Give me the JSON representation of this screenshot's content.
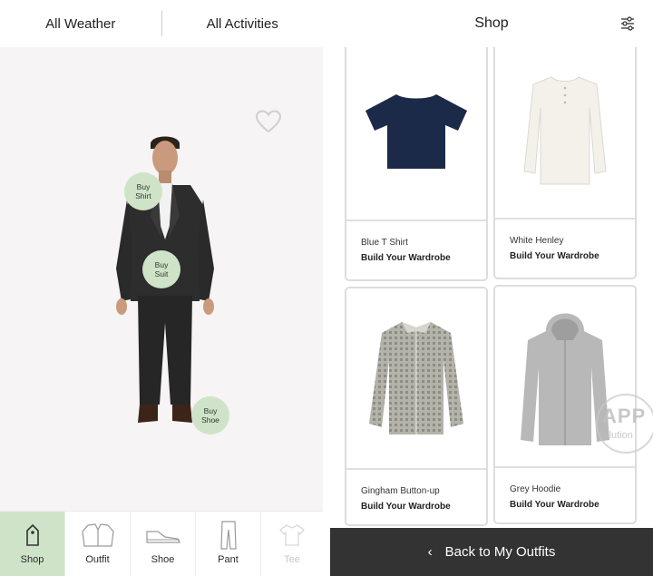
{
  "left_header": {
    "weather_filter": "All Weather",
    "activity_filter": "All Activities"
  },
  "outfit": {
    "buy_shirt": [
      "Buy",
      "Shirt"
    ],
    "buy_suit": [
      "Buy",
      "Suit"
    ],
    "buy_shoe": [
      "Buy",
      "Shoe"
    ]
  },
  "bottom_nav": [
    {
      "label": "Shop",
      "icon": "tag-icon",
      "active": true
    },
    {
      "label": "Outfit",
      "icon": "suit-icon"
    },
    {
      "label": "Shoe",
      "icon": "shoe-icon"
    },
    {
      "label": "Pant",
      "icon": "pant-icon"
    },
    {
      "label": "Tee",
      "icon": "tee-icon",
      "faded": true
    }
  ],
  "shop": {
    "title": "Shop",
    "filter_icon": "sliders-icon",
    "products": [
      {
        "name": "Blue T Shirt",
        "subtitle": "Build Your Wardrobe",
        "color": "#1c2a4a"
      },
      {
        "name": "White Henley",
        "subtitle": "Build Your Wardrobe",
        "color": "#f3f1ea"
      },
      {
        "name": "Gingham Button-up",
        "subtitle": "Build Your Wardrobe",
        "color": "#a9a89f"
      },
      {
        "name": "Grey Hoodie",
        "subtitle": "Build Your Wardrobe",
        "color": "#b8b8b8"
      }
    ],
    "back_button": "Back to My Outfits"
  },
  "watermark": {
    "line1": "APP",
    "line2": "solution"
  }
}
